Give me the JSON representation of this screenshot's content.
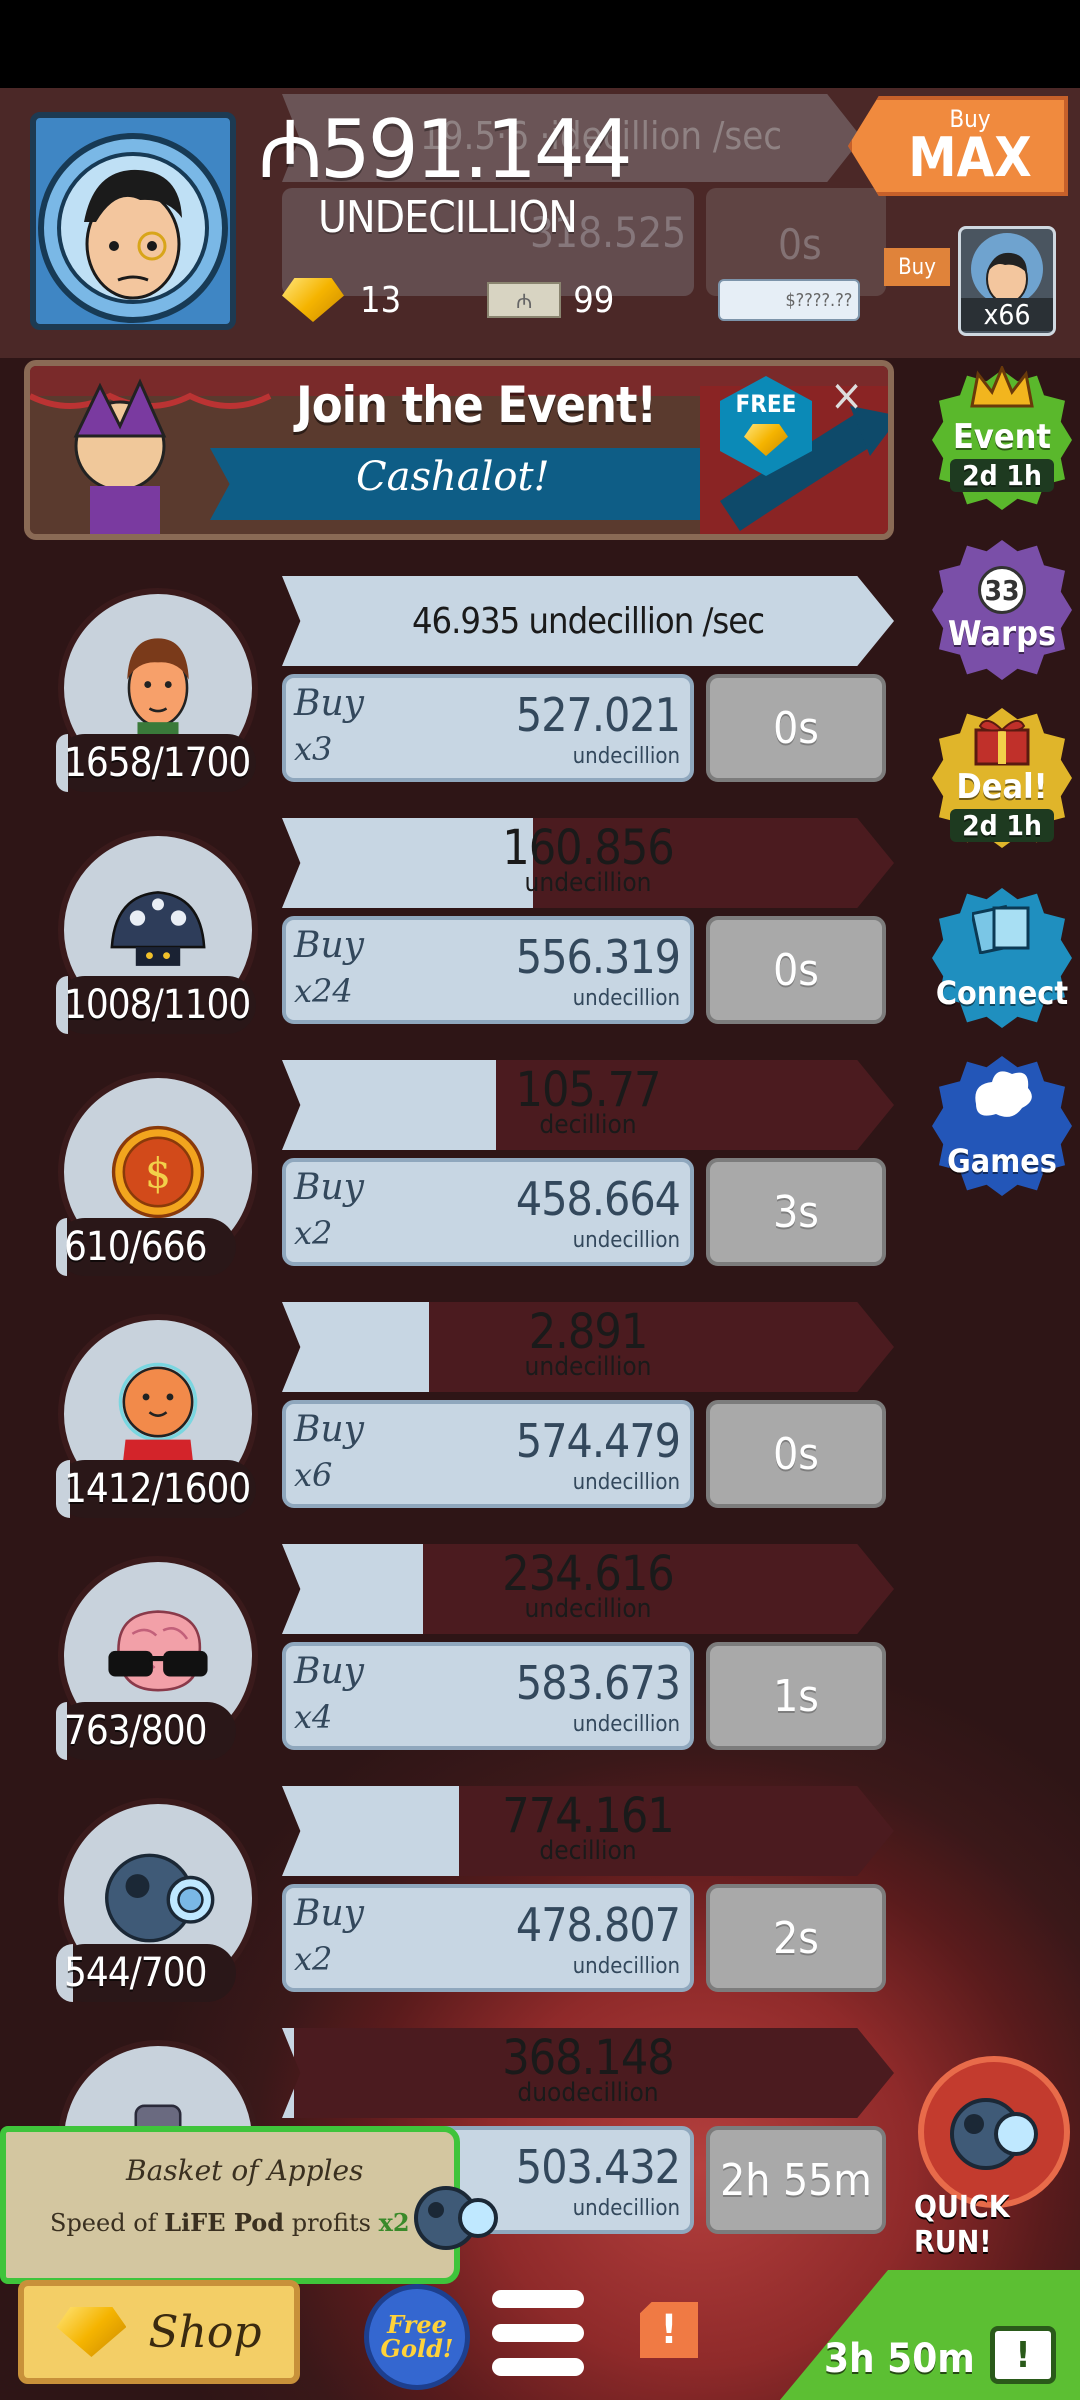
{
  "header": {
    "currency_symbol": "₼",
    "money_value": "591.144",
    "money_unit": "UNDECILLION",
    "ghost_rate": "19.5·6 ·idecillion /sec",
    "ghost_price": "318.525",
    "ghost_timer": "0s",
    "gold_count": "13",
    "bills_count": "99",
    "cheque_label": "$????.??",
    "buy_max_small": "Buy",
    "buy_max_big": "MAX",
    "buy_label": "Buy",
    "buy_unit_count": "x66"
  },
  "event": {
    "title": "Join the Event!",
    "subtitle": "Cashalot!",
    "free_label": "FREE",
    "close": "×"
  },
  "sidebar": [
    {
      "label": "Event",
      "sub": "2d 1h",
      "color": "#5ab82c"
    },
    {
      "label": "Warps",
      "badge": "33",
      "color": "#7a4fa8"
    },
    {
      "label": "Deal!",
      "sub": "2d 1h",
      "color": "#e0b52a"
    },
    {
      "label": "Connect",
      "color": "#1f8fbf"
    },
    {
      "label": "Games",
      "color": "#2356b8"
    }
  ],
  "units": [
    {
      "count": "1658/1700",
      "count_fill": 0.975,
      "progress": 1.0,
      "rate_text": "46.935 undecillion /sec",
      "value": "",
      "value_unit": "",
      "buy_mult": "x3",
      "price": "527.021",
      "price_unit": "undecillion",
      "timer": "0s"
    },
    {
      "count": "1008/1100",
      "count_fill": 0.916,
      "progress": 0.41,
      "rate_text": "",
      "value": "160.856",
      "value_unit": "undecillion",
      "buy_mult": "x24",
      "price": "556.319",
      "price_unit": "undecillion",
      "timer": "0s"
    },
    {
      "count": "610/666",
      "count_fill": 0.916,
      "progress": 0.35,
      "rate_text": "",
      "value": "105.77",
      "value_unit": "decillion",
      "buy_mult": "x2",
      "price": "458.664",
      "price_unit": "undecillion",
      "timer": "3s"
    },
    {
      "count": "1412/1600",
      "count_fill": 0.882,
      "progress": 0.24,
      "rate_text": "",
      "value": "2.891",
      "value_unit": "undecillion",
      "buy_mult": "x6",
      "price": "574.479",
      "price_unit": "undecillion",
      "timer": "0s"
    },
    {
      "count": "763/800",
      "count_fill": 0.954,
      "progress": 0.23,
      "rate_text": "",
      "value": "234.616",
      "value_unit": "undecillion",
      "buy_mult": "x4",
      "price": "583.673",
      "price_unit": "undecillion",
      "timer": "1s"
    },
    {
      "count": "544/700",
      "count_fill": 0.777,
      "progress": 0.29,
      "rate_text": "",
      "value": "774.161",
      "value_unit": "decillion",
      "buy_mult": "x2",
      "price": "478.807",
      "price_unit": "undecillion",
      "timer": "2s"
    },
    {
      "count": "",
      "count_fill": 0,
      "progress": 0.02,
      "rate_text": "",
      "value": "368.148",
      "value_unit": "duodecillion",
      "buy_mult": "",
      "price": "503.432",
      "price_unit": "undecillion",
      "timer": "2h 55m"
    }
  ],
  "buy_label": "Buy",
  "notification": {
    "title": "Basket of Apples",
    "line_prefix": "Speed of",
    "line_bold": "LiFE Pod",
    "line_suffix": "profits",
    "multiplier": "x2"
  },
  "footer": {
    "quick_run": "QUICK RUN!",
    "shop": "Shop",
    "free_gold": "Free Gold!",
    "alert": "!",
    "timer": "3h 50m",
    "tv": "!"
  }
}
